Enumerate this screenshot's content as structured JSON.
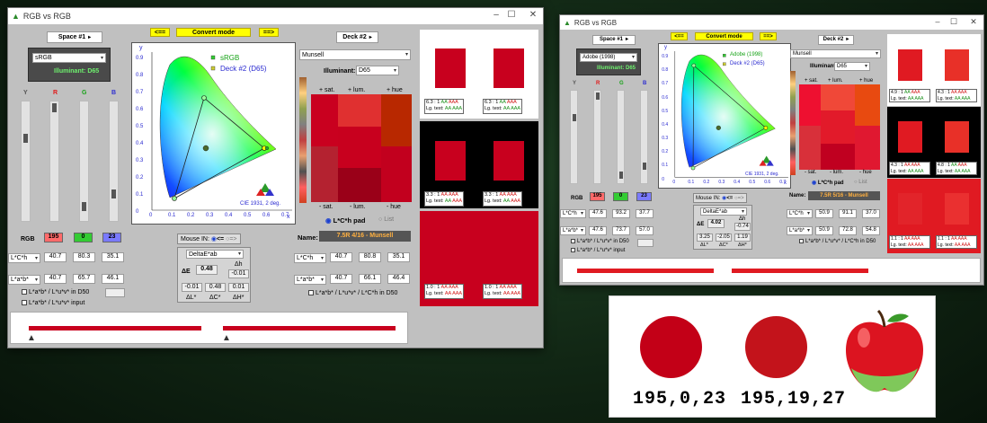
{
  "app_title": "RGB vs RGB",
  "buttons": {
    "prev": "<==",
    "convert": "Convert mode",
    "next": "==>"
  },
  "win1": {
    "space_label": "Space #1",
    "space_value": "sRGB",
    "illuminant": "Illuminant: D65",
    "chan": [
      "Y",
      "R",
      "G",
      "B"
    ],
    "chart": {
      "legend_space": "sRGB",
      "legend_deck": "Deck #2 (D65)",
      "caption": "CIE 1931, 2 deg.",
      "yticks": [
        "0.9",
        "0.8",
        "0.7",
        "0.6",
        "0.5",
        "0.4",
        "0.3",
        "0.2",
        "0.1",
        "0"
      ],
      "xticks": [
        "0",
        "0.1",
        "0.2",
        "0.3",
        "0.4",
        "0.5",
        "0.6",
        "0.7"
      ],
      "xlabel": "x",
      "ylabel": "y"
    },
    "rgb_label": "RGB",
    "rgb": [
      "195",
      "0",
      "23"
    ],
    "lch_label": "L*C*h",
    "lch": [
      "40.7",
      "80.3",
      "35.1"
    ],
    "lab_label": "L*a*b*",
    "lab": [
      "40.7",
      "65.7",
      "46.1"
    ],
    "opt1": "L*a*b* / L*u*v* in D50",
    "opt2": "L*a*b* / L*u*v* input",
    "mouse_label": "Mouse IN:",
    "mouse_opt1": "<=",
    "mouse_opt2": "=>",
    "delta_mode": "DeltaE*ab",
    "delta_label": "ΔE",
    "delta_value": "0.48",
    "dh_label": "Δh",
    "dh": "-0.01",
    "dvals": [
      "-0.01",
      "0.48",
      "0.01"
    ],
    "dlabels": [
      "ΔL*",
      "ΔC*",
      "ΔH*"
    ],
    "deck_label": "Deck #2",
    "deck_value": "Munsell",
    "illum2_label": "Illuminant:",
    "illum2_value": "D65",
    "grid_top": [
      "+ sat.",
      "+ lum.",
      "+ hue"
    ],
    "grid_bot": [
      "- sat.",
      "- lum.",
      "- hue"
    ],
    "pad_opt1": "L*C*h pad",
    "pad_opt2": "List",
    "name_label": "Name:",
    "name_value": "7.5R 4/16 - Munsell",
    "lch2": [
      "40.7",
      "80.8",
      "35.1"
    ],
    "lab2": [
      "40.7",
      "66.1",
      "46.4"
    ],
    "opt3": "L*a*b* / L*u*v* / L*C*h in D50",
    "cr": [
      {
        "ratio": "6.3 : 1",
        "aa": "AA",
        "aaa": "AAA"
      },
      {
        "ratio": "6.3 : 1",
        "aa": "AA",
        "aaa": "AAA"
      },
      {
        "ratio": "3.3 : 1",
        "aa": "AA",
        "aaa": "AAA"
      },
      {
        "ratio": "3.3 : 1",
        "aa": "AA",
        "aaa": "AAA"
      },
      {
        "ratio": "1.0 : 1",
        "aa": "AA",
        "aaa": "AAA"
      },
      {
        "ratio": "1.0 : 1",
        "aa": "AA",
        "aaa": "AAA"
      }
    ],
    "lg_text": "Lg. text:"
  },
  "win2": {
    "space_label": "Space #1",
    "space_value": "Adobe (1998)",
    "illuminant": "Illuminant: D65",
    "chan": [
      "Y",
      "R",
      "G",
      "B"
    ],
    "chart": {
      "legend_space": "Adobe (1998)",
      "legend_deck": "Deck #2 (D65)",
      "caption": "CIE 1931, 2 deg.",
      "yticks": [
        "0.9",
        "0.8",
        "0.7",
        "0.6",
        "0.5",
        "0.4",
        "0.3",
        "0.2",
        "0.1",
        "0"
      ],
      "xticks": [
        "0",
        "0.1",
        "0.2",
        "0.3",
        "0.4",
        "0.5",
        "0.6",
        "0.7"
      ],
      "xlabel": "x",
      "ylabel": "y"
    },
    "rgb_label": "RGB",
    "rgb": [
      "195",
      "0",
      "23"
    ],
    "lch_label": "L*C*h",
    "lch": [
      "47.6",
      "93.2",
      "37.7"
    ],
    "lab_label": "L*a*b*",
    "lab": [
      "47.6",
      "73.7",
      "57.0"
    ],
    "lch2": [
      "50.9",
      "91.1",
      "37.0"
    ],
    "lab2": [
      "50.9",
      "72.8",
      "54.8"
    ],
    "opt1": "L*a*b* / L*u*v* in D50",
    "opt2": "L*a*b* / L*u*v* input",
    "opt3": "L*a*b* / L*u*v* / L*C*h in D50",
    "mouse_label": "Mouse IN:",
    "mouse_opt1": "<=",
    "mouse_opt2": "=>",
    "delta_mode": "DeltaE*ab",
    "delta_label": "ΔE",
    "delta_value": "4.02",
    "dh_label": "Δh",
    "dh": "-0.74",
    "dvals": [
      "3.25",
      "-2.05",
      "1.19"
    ],
    "dlabels": [
      "ΔL*",
      "ΔC*",
      "ΔH*"
    ],
    "deck_label": "Deck #2",
    "deck_value": "Munsell",
    "illum2_label": "Illuminant:",
    "illum2_value": "D65",
    "grid_top": [
      "+ sat.",
      "+ lum.",
      "+ hue"
    ],
    "grid_bot": [
      "- sat.",
      "- lum.",
      "- hue"
    ],
    "pad_opt1": "L*C*h pad",
    "pad_opt2": "List",
    "name_label": "Name:",
    "name_value": "7.5R 5/16 - Munsell",
    "cr": [
      {
        "ratio": "4.9 : 1",
        "aa": "AA",
        "aaa": "AAA"
      },
      {
        "ratio": "4.3 : 1",
        "aa": "AA",
        "aaa": "AAA"
      },
      {
        "ratio": "4.3 : 1",
        "aa": "AA",
        "aaa": "AAA"
      },
      {
        "ratio": "4.8 : 1",
        "aa": "AA",
        "aaa": "AAA"
      },
      {
        "ratio": "1.1 : 1",
        "aa": "AA",
        "aaa": "AAA"
      },
      {
        "ratio": "1.1 : 1",
        "aa": "AA",
        "aaa": "AAA"
      }
    ],
    "lg_text": "Lg. text:"
  },
  "comparison": {
    "label1": "195,0,23",
    "label2": "195,19,27",
    "color1": "#c30017",
    "color2": "#c3131b"
  },
  "colors": {
    "red": "#c30017",
    "red2": "#e02020",
    "green_sw": "#33cc33",
    "blue_sw": "#7a7aff",
    "red_sw": "#ff6a6a",
    "yellow": "#ffff00"
  }
}
